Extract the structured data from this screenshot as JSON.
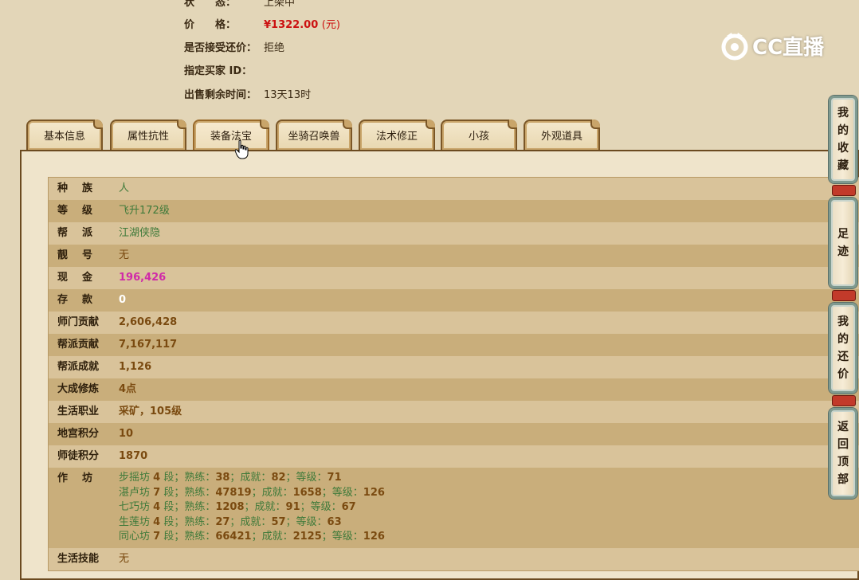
{
  "info": {
    "status_label": "状　　态：",
    "status_value": "上架中",
    "price_label": "价　　格：",
    "price_value": "¥1322.00",
    "price_unit": "(元)",
    "bargain_label": "是否接受还价：",
    "bargain_value": "拒绝",
    "buyer_label": "指定买家 ID：",
    "buyer_value": "",
    "remaining_label": "出售剩余时间：",
    "remaining_value": "13天13时"
  },
  "watermark": {
    "text": "CC直播"
  },
  "tabs": [
    {
      "label": "基本信息"
    },
    {
      "label": "属性抗性"
    },
    {
      "label": "装备法宝"
    },
    {
      "label": "坐骑召唤兽"
    },
    {
      "label": "法术修正"
    },
    {
      "label": "小孩"
    },
    {
      "label": "外观道具"
    }
  ],
  "attributes": [
    {
      "key": "种族",
      "value": "人"
    },
    {
      "key": "等级",
      "value": "飞升172级"
    },
    {
      "key": "帮派",
      "value": "江湖侠隐"
    },
    {
      "key": "靓号",
      "value": "无"
    },
    {
      "key": "现金",
      "value": "196,426"
    },
    {
      "key": "存款",
      "value": "0"
    },
    {
      "key": "师门贡献",
      "value": "2,606,428"
    },
    {
      "key": "帮派贡献",
      "value": "7,167,117"
    },
    {
      "key": "帮派成就",
      "value": "1,126"
    },
    {
      "key": "大成修炼",
      "value": "4点"
    },
    {
      "key": "生活职业",
      "value": "采矿，105级"
    },
    {
      "key": "地宫积分",
      "value": "10"
    },
    {
      "key": "师徒积分",
      "value": "1870"
    },
    {
      "key": "作坊",
      "value": ""
    },
    {
      "key": "生活技能",
      "value": "无"
    }
  ],
  "workshops": [
    {
      "name": "步摇坊",
      "seg": "4",
      "proficiency": "38",
      "achievement": "82",
      "level": "71"
    },
    {
      "name": "湛卢坊",
      "seg": "7",
      "proficiency": "47819",
      "achievement": "1658",
      "level": "126"
    },
    {
      "name": "七巧坊",
      "seg": "4",
      "proficiency": "1208",
      "achievement": "91",
      "level": "67"
    },
    {
      "name": "生莲坊",
      "seg": "4",
      "proficiency": "27",
      "achievement": "57",
      "level": "63"
    },
    {
      "name": "同心坊",
      "seg": "7",
      "proficiency": "66421",
      "achievement": "2125",
      "level": "126"
    }
  ],
  "workshop_labels": {
    "seg": "段；",
    "proficiency": "熟练：",
    "achievement": "成就：",
    "level": "等级：",
    "sep": "；"
  },
  "side_buttons": [
    {
      "label": "我的收藏"
    },
    {
      "label": "足迹"
    },
    {
      "label": "我的还价"
    },
    {
      "label": "返回顶部"
    }
  ],
  "colors": {
    "price": "#cc1111",
    "cash": "#d02aa8",
    "value_green": "#3f7a3a",
    "value_brown": "#7a4a10"
  }
}
